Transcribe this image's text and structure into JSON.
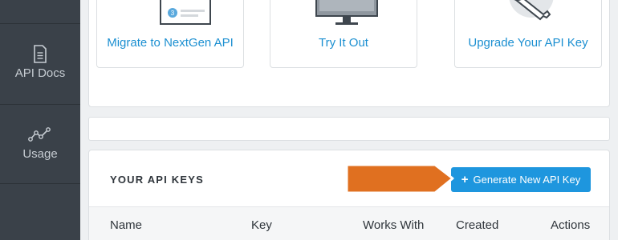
{
  "sidebar": {
    "items": [
      {
        "label": "API Docs",
        "icon": "document-icon"
      },
      {
        "label": "Usage",
        "icon": "line-chart-icon"
      }
    ]
  },
  "tiles": [
    {
      "label": "Migrate to NextGen API",
      "icon": "card-icon",
      "badge": "3"
    },
    {
      "label": "Try It Out",
      "icon": "monitor-icon"
    },
    {
      "label": "Upgrade Your API Key",
      "icon": "key-icon"
    }
  ],
  "keys": {
    "title": "YOUR API KEYS",
    "generate_button": {
      "plus": "+",
      "label": "Generate New API Key"
    },
    "columns": [
      "Name",
      "Key",
      "Works With",
      "Created",
      "Actions"
    ]
  },
  "colors": {
    "sidebar_bg": "#3a4149",
    "accent": "#1e96de",
    "link": "#1b8fd1",
    "arrow": "#e07020"
  }
}
